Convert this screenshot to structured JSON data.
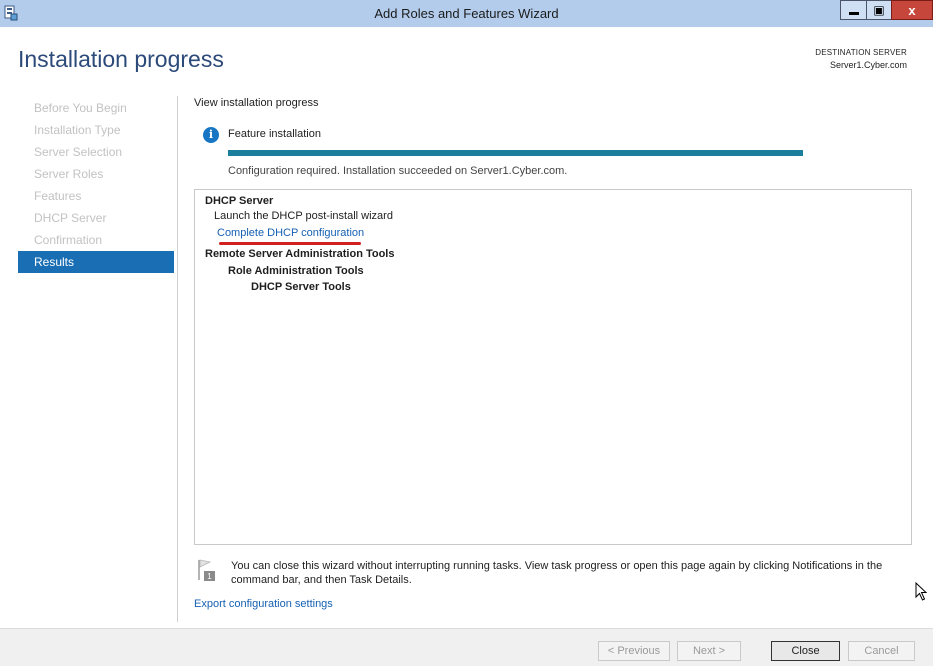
{
  "window": {
    "title": "Add Roles and Features Wizard",
    "close_glyph": "x",
    "max_glyph": "▣"
  },
  "header": {
    "page_title": "Installation progress",
    "destination_label": "DESTINATION SERVER",
    "destination_server": "Server1.Cyber.com"
  },
  "nav": {
    "items": [
      {
        "label": "Before You Begin"
      },
      {
        "label": "Installation Type"
      },
      {
        "label": "Server Selection"
      },
      {
        "label": "Server Roles"
      },
      {
        "label": "Features"
      },
      {
        "label": "DHCP Server"
      },
      {
        "label": "Confirmation"
      },
      {
        "label": "Results"
      }
    ],
    "active_index": 7
  },
  "main": {
    "view_label": "View installation progress",
    "info_glyph": "i",
    "feature_label": "Feature installation",
    "progress_fraction": 1.0,
    "status_text": "Configuration required. Installation succeeded on Server1.Cyber.com.",
    "results": {
      "dhcp_server": "DHCP Server",
      "launch_wizard": "Launch the DHCP post-install wizard",
      "complete_link": "Complete DHCP configuration",
      "rsat": "Remote Server Administration Tools",
      "role_admin": "Role Administration Tools",
      "dhcp_tools": "DHCP Server Tools"
    },
    "note": "You can close this wizard without interrupting running tasks. View task progress or open this page again by clicking Notifications in the command bar, and then Task Details.",
    "note_badge": "1",
    "export_link": "Export configuration settings"
  },
  "footer": {
    "previous": "< Previous",
    "next": "Next >",
    "close": "Close",
    "cancel": "Cancel"
  },
  "colors": {
    "accent": "#1a6fb4",
    "progress": "#1a7e9c",
    "link": "#1560b3",
    "annotation": "#d21f1f"
  }
}
